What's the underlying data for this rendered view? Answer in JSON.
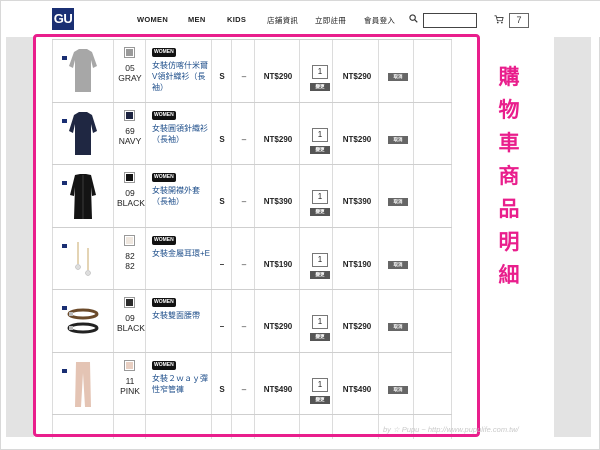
{
  "header": {
    "logo": "GU",
    "nav": [
      "WOMEN",
      "MEN",
      "KIDS",
      "店鋪資訊",
      "立即註冊",
      "會員登入"
    ],
    "cart_count": "7",
    "search_placeholder": ""
  },
  "cart": {
    "update_label": "變更",
    "cancel_label": "取消",
    "tag_label": "WOMEN",
    "items": [
      {
        "code": "05",
        "color": "GRAY",
        "name": "女裝仿喀什米爾V領針織衫（長袖）",
        "size": "S",
        "dash": "–",
        "price": "NT$290",
        "qty": "1",
        "total": "NT$290",
        "swatch": "#9a9a9a",
        "garment": "#a7a7a7"
      },
      {
        "code": "69",
        "color": "NAVY",
        "name": "女裝圓領針織衫（長袖）",
        "size": "S",
        "dash": "–",
        "price": "NT$290",
        "qty": "1",
        "total": "NT$290",
        "swatch": "#1c2340",
        "garment": "#1f2742"
      },
      {
        "code": "09",
        "color": "BLACK",
        "name": "女裝開襟外套（長袖）",
        "size": "S",
        "dash": "–",
        "price": "NT$390",
        "qty": "1",
        "total": "NT$390",
        "swatch": "#111111",
        "garment": "#141414"
      },
      {
        "code": "82",
        "color": "82",
        "name": "女裝金屬耳環+E",
        "size": "–",
        "dash": "–",
        "price": "NT$190",
        "qty": "1",
        "total": "NT$190",
        "swatch": "#efe7df",
        "garment": "#c9a96a"
      },
      {
        "code": "09",
        "color": "BLACK",
        "name": "女裝雙面腰帶",
        "size": "–",
        "dash": "–",
        "price": "NT$290",
        "qty": "1",
        "total": "NT$290",
        "swatch": "#2b2b2b",
        "garment": "#2a2a2a"
      },
      {
        "code": "11",
        "color": "PINK",
        "name": "女裝２ｗａｙ彈性窄管褲",
        "size": "S",
        "dash": "–",
        "price": "NT$490",
        "qty": "1",
        "total": "NT$490",
        "swatch": "#e8cfc2",
        "garment": "#e4c4b4"
      }
    ]
  },
  "annotation": {
    "title_chars": [
      "購",
      "物",
      "車",
      "商",
      "品",
      "明",
      "細"
    ]
  },
  "watermark": "by ☆ Pupu ~ http://www.pupulife.com.tw/"
}
